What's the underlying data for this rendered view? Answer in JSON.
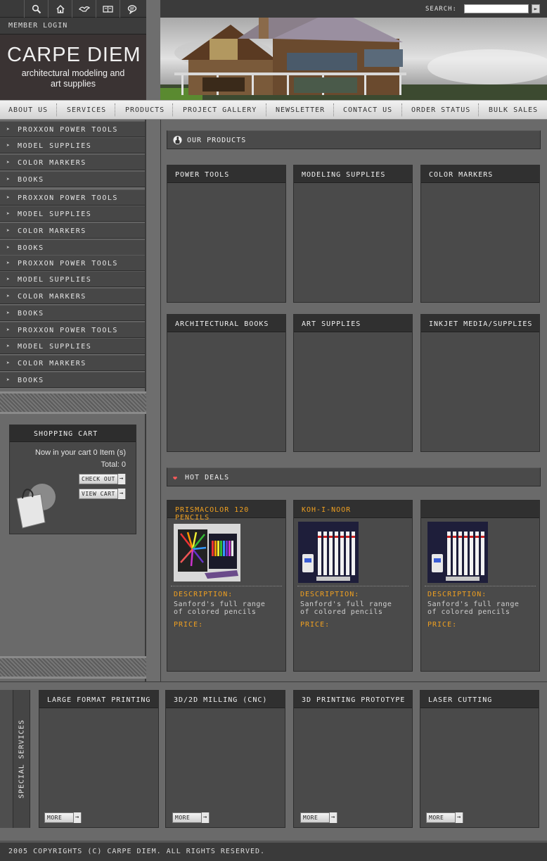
{
  "header": {
    "member_login": "MEMBER LOGIN",
    "logo_title": "CARPE DIEM",
    "logo_subtitle_line1": "architectural modeling and",
    "logo_subtitle_line2": "art supplies",
    "search_label": "SEARCH:",
    "search_value": "",
    "icons": [
      "search-icon",
      "home-icon",
      "bird-icon",
      "book-icon",
      "chat-icon"
    ]
  },
  "nav": [
    "ABOUT US",
    "SERVICES",
    "PRODUCTS",
    "PROJECT GALLERY",
    "NEWSLETTER",
    "CONTACT US",
    "ORDER STATUS",
    "BULK SALES"
  ],
  "sidebar": {
    "items": [
      "PROXXON POWER TOOLS",
      "MODEL SUPPLIES",
      "COLOR MARKERS",
      "BOOKS",
      "PROXXON POWER TOOLS",
      "MODEL SUPPLIES",
      "COLOR MARKERS",
      "BOOKS",
      "PROXXON POWER TOOLS",
      "MODEL SUPPLIES",
      "COLOR MARKERS",
      "BOOKS",
      "PROXXON POWER TOOLS",
      "MODEL SUPPLIES",
      "COLOR MARKERS",
      "BOOKS"
    ]
  },
  "cart": {
    "title": "SHOPPING CART",
    "now_text": "Now in your cart 0 Item (s)",
    "total_text": "Total: 0",
    "checkout_label": "CHECK OUT",
    "view_label": "VIEW CART"
  },
  "products": {
    "title": "OUR PRODUCTS",
    "panels": [
      "POWER TOOLS",
      "MODELING SUPPLIES",
      "COLOR MARKERS",
      "ARCHITECTURAL BOOKS",
      "ART SUPPLIES",
      "INKJET MEDIA/SUPPLIES"
    ]
  },
  "hot_deals": {
    "title": "HOT DEALS",
    "deals": [
      {
        "name": "PRISMACOLOR 120 PENCILS",
        "desc_label": "DESCRIPTION:",
        "desc1": "Sanford's full range",
        "desc2": "of colored pencils",
        "price_label": "PRICE:"
      },
      {
        "name": "KOH-I-NOOR",
        "desc_label": "DESCRIPTION:",
        "desc1": "Sanford's full range",
        "desc2": "of colored pencils",
        "price_label": "PRICE:"
      },
      {
        "name": "",
        "desc_label": "DESCRIPTION:",
        "desc1": "Sanford's full range",
        "desc2": "of colored pencils",
        "price_label": "PRICE:"
      }
    ]
  },
  "services": {
    "tab_label": "SPECIAL SERVICES",
    "items": [
      {
        "title": "LARGE FORMAT PRINTING",
        "more": "MORE"
      },
      {
        "title": "3D/2D MILLING (CNC)",
        "more": "MORE"
      },
      {
        "title": "3D PRINTING PROTOTYPE",
        "more": "MORE"
      },
      {
        "title": "LASER CUTTING",
        "more": "MORE"
      }
    ]
  },
  "footer": "2005 COPYRIGHTS (C) CARPE DIEM. ALL RIGHTS RESERVED.",
  "colors": {
    "accent": "#f0a020",
    "panel": "#4a4a4a",
    "panel_head": "#303030"
  }
}
